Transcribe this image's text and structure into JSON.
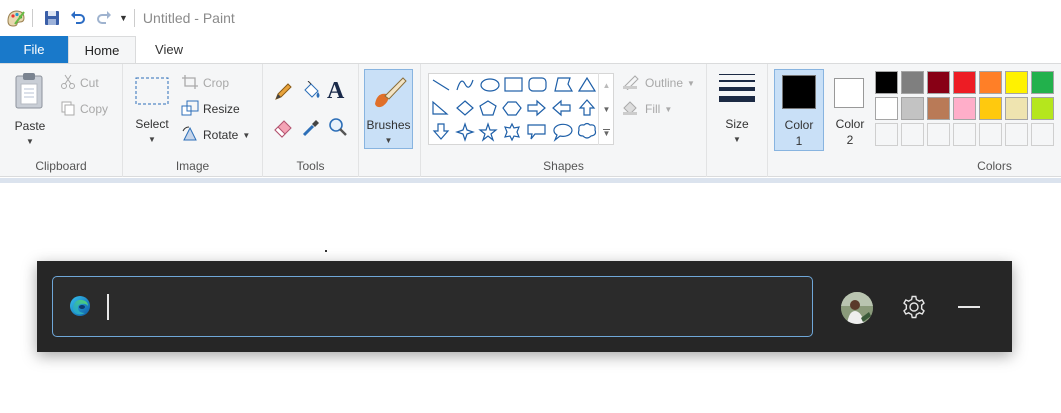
{
  "window": {
    "title": "Untitled - Paint"
  },
  "quick_access": [
    "save-icon",
    "undo-icon",
    "redo-icon",
    "customize-dropdown-icon"
  ],
  "tabs": {
    "file": "File",
    "home": "Home",
    "view": "View"
  },
  "ribbon": {
    "clipboard": {
      "group_label": "Clipboard",
      "paste": "Paste",
      "cut": "Cut",
      "copy": "Copy"
    },
    "image": {
      "group_label": "Image",
      "select": "Select",
      "crop": "Crop",
      "resize": "Resize",
      "rotate": "Rotate"
    },
    "tools": {
      "group_label": "Tools"
    },
    "brushes": {
      "label": "Brushes"
    },
    "shapes": {
      "group_label": "Shapes",
      "outline": "Outline",
      "fill": "Fill"
    },
    "size": {
      "label": "Size"
    },
    "colors": {
      "group_label": "Colors",
      "color1_line1": "Color",
      "color1_line2": "1",
      "color2_line1": "Color",
      "color2_line2": "2",
      "color1_value": "#000000",
      "color2_value": "#ffffff",
      "palette_row1": [
        "#000000",
        "#7f7f7f",
        "#880015",
        "#ed1c24",
        "#ff7f27",
        "#fff200",
        "#22b14c"
      ],
      "palette_row2": [
        "#ffffff",
        "#c3c3c3",
        "#b97a57",
        "#ffaec9",
        "#ffc90e",
        "#efe4b0",
        "#b5e61d"
      ]
    }
  },
  "overlay": {
    "search": {
      "value": "",
      "placeholder": ""
    },
    "icons": [
      "edge-icon",
      "avatar",
      "settings-gear-icon",
      "minimize-icon"
    ]
  }
}
